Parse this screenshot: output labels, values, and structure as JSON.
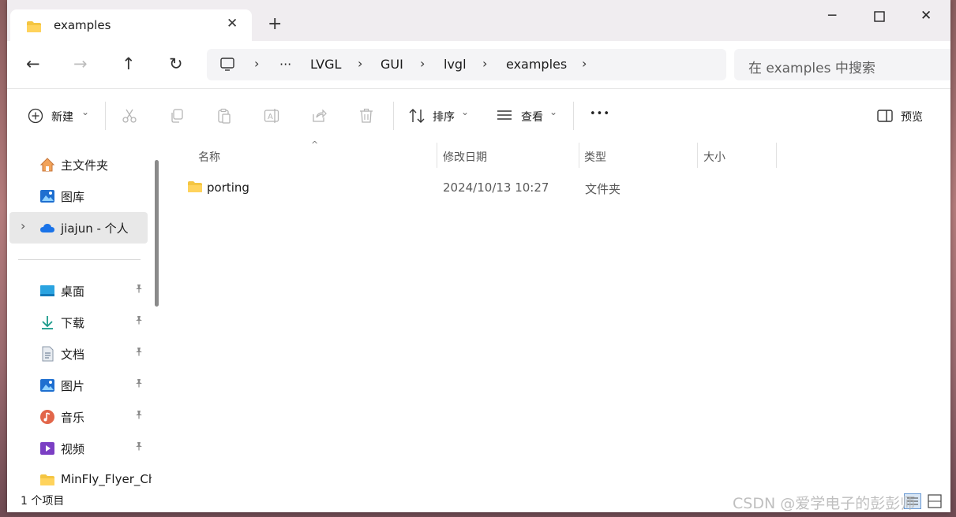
{
  "tab": {
    "title": "examples",
    "close": "✕",
    "new": "+"
  },
  "window": {
    "minimize": "─",
    "maximize": "☐",
    "close": "✕"
  },
  "nav": {
    "back": "←",
    "forward": "→",
    "up": "↑",
    "refresh": "↻"
  },
  "address": {
    "more": "···",
    "separator": "›",
    "crumbs": [
      "LVGL",
      "GUI",
      "lvgl",
      "examples"
    ]
  },
  "search": {
    "placeholder": "在 examples 中搜索"
  },
  "commands": {
    "new_label": "新建",
    "sort_label": "排序",
    "view_label": "查看",
    "more": "•••",
    "preview_label": "预览",
    "dropdown": "⌄"
  },
  "sidebar": {
    "items": [
      {
        "label": "主文件夹"
      },
      {
        "label": "图库"
      },
      {
        "label": "jiajun - 个人"
      },
      {
        "label": "桌面"
      },
      {
        "label": "下载"
      },
      {
        "label": "文档"
      },
      {
        "label": "图片"
      },
      {
        "label": "音乐"
      },
      {
        "label": "视频"
      },
      {
        "label": "MinFly_Flyer_Ch"
      }
    ],
    "expand_glyph": "›",
    "pin_glyph": "📌"
  },
  "columns": {
    "name": "名称",
    "modified": "修改日期",
    "type": "类型",
    "size": "大小",
    "sort_caret": "^"
  },
  "files": [
    {
      "name": "porting",
      "modified": "2024/10/13 10:27",
      "type": "文件夹",
      "size": ""
    }
  ],
  "status": {
    "count": "1 个项目"
  },
  "watermark": "CSDN @爱学电子的彭彭师",
  "colors": {
    "accent": "#0067c0",
    "folder": "#f4c542"
  }
}
